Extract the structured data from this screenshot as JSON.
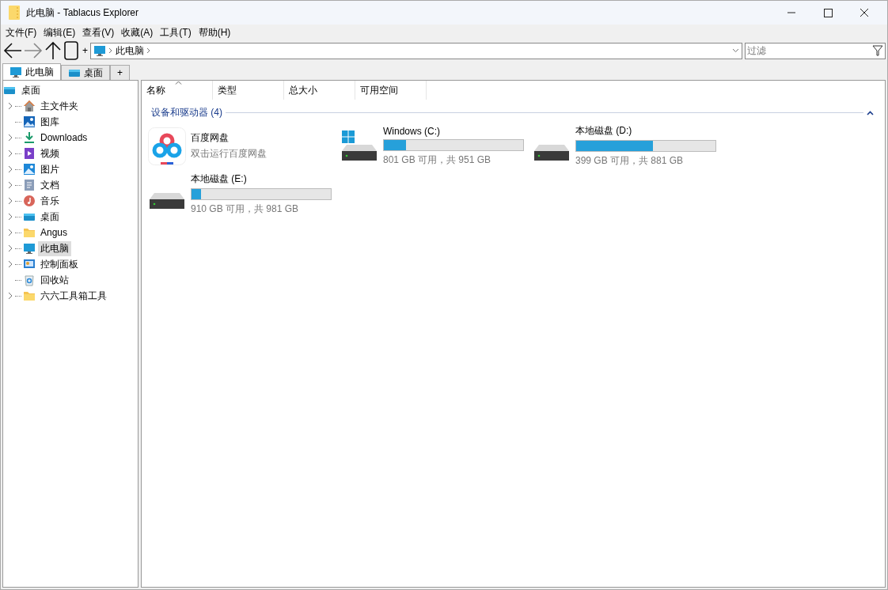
{
  "window": {
    "title": "此电脑 - Tablacus Explorer"
  },
  "menu": [
    "文件(F)",
    "编辑(E)",
    "查看(V)",
    "收藏(A)",
    "工具(T)",
    "帮助(H)"
  ],
  "toolbar": {
    "new_tab": "+",
    "breadcrumb": [
      "此电脑"
    ],
    "filter": {
      "placeholder": "过滤"
    }
  },
  "tabs": [
    {
      "label": "此电脑",
      "selected": true
    },
    {
      "label": "桌面",
      "selected": false
    },
    {
      "label": "+",
      "selected": false
    }
  ],
  "tree": {
    "label": "桌面",
    "children": [
      {
        "label": "主文件夹",
        "expandable": true,
        "selected": false
      },
      {
        "label": "图库",
        "expandable": false,
        "selected": false
      },
      {
        "label": "Downloads",
        "expandable": true,
        "selected": false
      },
      {
        "label": "视频",
        "expandable": true,
        "selected": false
      },
      {
        "label": "图片",
        "expandable": true,
        "selected": false
      },
      {
        "label": "文档",
        "expandable": true,
        "selected": false
      },
      {
        "label": "音乐",
        "expandable": true,
        "selected": false
      },
      {
        "label": "桌面",
        "expandable": true,
        "selected": false
      },
      {
        "label": "Angus",
        "expandable": true,
        "selected": false
      },
      {
        "label": "此电脑",
        "expandable": true,
        "selected": true
      },
      {
        "label": "控制面板",
        "expandable": true,
        "selected": false
      },
      {
        "label": "回收站",
        "expandable": false,
        "selected": false
      },
      {
        "label": "六六工具箱工具",
        "expandable": true,
        "selected": false
      }
    ]
  },
  "columns": [
    {
      "label": "名称",
      "sorted": true
    },
    {
      "label": "类型",
      "sorted": false
    },
    {
      "label": "总大小",
      "sorted": false
    },
    {
      "label": "可用空间",
      "sorted": false
    }
  ],
  "group": {
    "label": "设备和驱动器 (4)",
    "expanded": true
  },
  "items": [
    {
      "kind": "app",
      "name": "百度网盘",
      "subtitle": "双击运行百度网盘"
    },
    {
      "kind": "drive",
      "name": "Windows (C:)",
      "system": true,
      "level": 0.16,
      "space": "801 GB 可用，共 951 GB"
    },
    {
      "kind": "drive",
      "name": "本地磁盘 (D:)",
      "system": false,
      "level": 0.55,
      "space": "399 GB 可用，共 881 GB"
    },
    {
      "kind": "drive",
      "name": "本地磁盘 (E:)",
      "system": false,
      "level": 0.07,
      "space": "910 GB 可用，共 981 GB"
    }
  ]
}
